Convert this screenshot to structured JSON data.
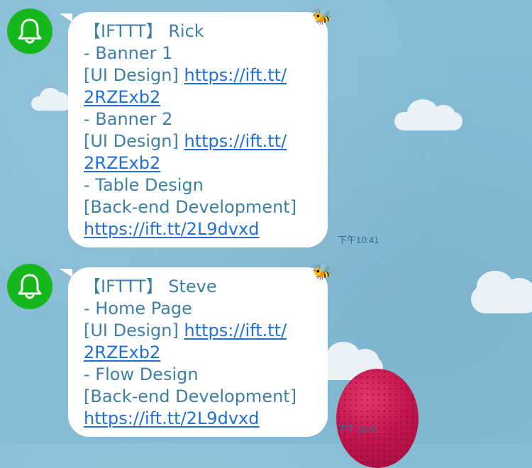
{
  "messages": [
    {
      "title": "【IFTTT】 Rick",
      "lines": [
        {
          "text": " - Banner 1"
        },
        {
          "prefix": "[UI Design] ",
          "link1": "https://ift.tt/",
          "link2": "2RZExb2"
        },
        {
          "text": " - Banner 2"
        },
        {
          "prefix": "[UI Design] ",
          "link1": "https://ift.tt/",
          "link2": "2RZExb2"
        },
        {
          "text": " - Table Design"
        },
        {
          "prefix": "[Back-end Development]",
          "link2": "https://ift.tt/2L9dvxd"
        }
      ],
      "time": "下午10:41"
    },
    {
      "title": "【IFTTT】 Steve",
      "lines": [
        {
          "text": " - Home Page"
        },
        {
          "prefix": "[UI Design] ",
          "link1": "https://ift.tt/",
          "link2": "2RZExb2"
        },
        {
          "text": " - Flow Design"
        },
        {
          "prefix": "[Back-end Development]",
          "link2": "https://ift.tt/2L9dvxd"
        }
      ],
      "time": "下午10:41"
    }
  ],
  "icons": {
    "avatar": "bell-icon",
    "sticker": "bee-icon"
  },
  "colors": {
    "background": "#86bcd6",
    "avatar": "#16b61d",
    "text": "#3e7fa6",
    "link": "#1f6fd9"
  }
}
